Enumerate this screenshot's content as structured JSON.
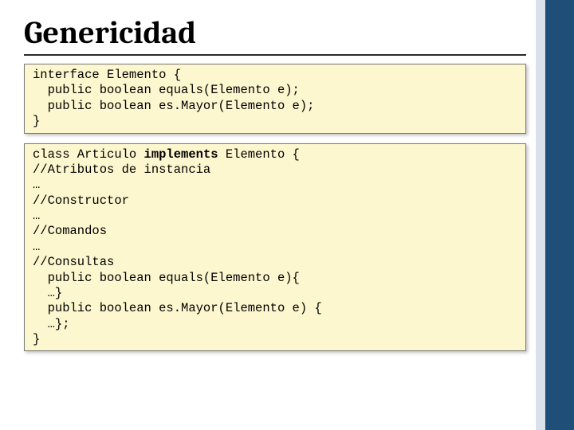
{
  "title": "Genericidad",
  "box1": {
    "l1": "interface Elemento {",
    "l2": "  public boolean equals(Elemento e);",
    "l3": "  public boolean es.Mayor(Elemento e);",
    "l4": "}"
  },
  "box2": {
    "l1a": "class Articulo ",
    "l1b": "implements",
    "l1c": " Elemento {",
    "l2": "//Atributos de instancia",
    "l3": "…",
    "l4": "//Constructor",
    "l5": "…",
    "l6": "//Comandos",
    "l7": "…",
    "l8": "//Consultas",
    "l9": "  public boolean equals(Elemento e){",
    "l10": "  …}",
    "l11": "  public boolean es.Mayor(Elemento e) {",
    "l12": "  …};",
    "l13": "",
    "l14": "}"
  }
}
